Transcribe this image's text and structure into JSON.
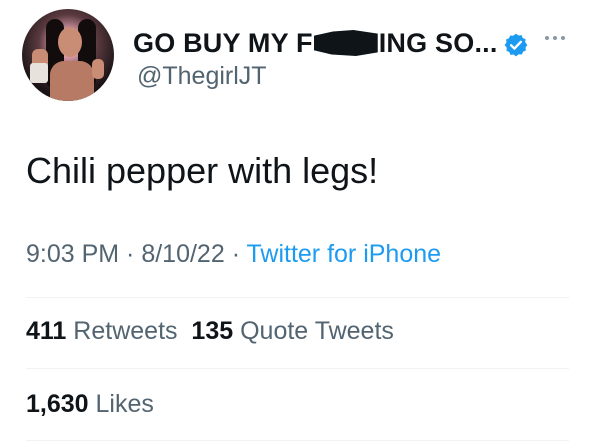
{
  "author": {
    "display_name_before": "GO BUY MY F",
    "display_name_after": "ING SO...",
    "handle": "@ThegirlJT",
    "verified_color": "#1d9bf0"
  },
  "tweet": {
    "text": "Chili pepper with legs!",
    "time": "9:03 PM",
    "separator1": " · ",
    "date": "8/10/22",
    "separator2": " · ",
    "source": "Twitter for iPhone"
  },
  "stats": {
    "retweets_count": "411",
    "retweets_label": "Retweets",
    "quotes_count": "135",
    "quotes_label": "Quote Tweets",
    "likes_count": "1,630",
    "likes_label": "Likes"
  },
  "colors": {
    "text_primary": "#0f1419",
    "text_secondary": "#536471",
    "link": "#1d9bf0",
    "divider": "#eff3f4"
  },
  "icons": {
    "verified": "verified-badge-icon",
    "more": "more-options-icon"
  }
}
